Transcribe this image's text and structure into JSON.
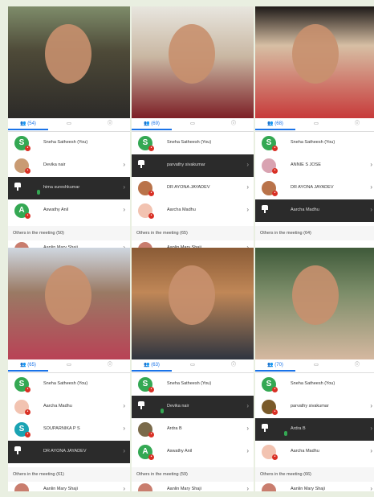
{
  "panels": [
    {
      "count": "(54)",
      "rows": [
        {
          "name": "Sneha Satheesh (You)",
          "avatar": "S",
          "color": "#34a853",
          "dark": false,
          "mic": false
        },
        {
          "name": "Devika nair",
          "avatar": "",
          "color": "#c99b73",
          "dark": false,
          "mic": false
        },
        {
          "name": "hima sureshkumar",
          "avatar": "",
          "color": "#2b2b2b",
          "dark": true,
          "mic": true
        },
        {
          "name": "Aswathy Anil",
          "avatar": "A",
          "color": "#34a853",
          "dark": false,
          "mic": false
        }
      ],
      "others": "Others in the meeting (50)",
      "next": "Aanlin Mary Shaji"
    },
    {
      "count": "(69)",
      "rows": [
        {
          "name": "Sneha Satheesh (You)",
          "avatar": "S",
          "color": "#34a853",
          "dark": false,
          "mic": false
        },
        {
          "name": "parvathy sivakumar",
          "avatar": "",
          "color": "#2b2b2b",
          "dark": true,
          "mic": false
        },
        {
          "name": "DR AYONA JAYADEV",
          "avatar": "",
          "color": "#b9734a",
          "dark": false,
          "mic": false
        },
        {
          "name": "Aarcha Madhu",
          "avatar": "",
          "color": "#f2c3b1",
          "dark": false,
          "mic": false
        }
      ],
      "others": "Others in the meeting (65)",
      "next": "Aanlin Mary Shaji"
    },
    {
      "count": "(68)",
      "rows": [
        {
          "name": "Sneha Satheesh (You)",
          "avatar": "S",
          "color": "#34a853",
          "dark": false,
          "mic": false
        },
        {
          "name": "ANNIE S JOSE",
          "avatar": "",
          "color": "#d9a3b1",
          "dark": false,
          "mic": false
        },
        {
          "name": "DR AYONA JAYADEV",
          "avatar": "",
          "color": "#b9734a",
          "dark": false,
          "mic": false
        },
        {
          "name": "Aarcha Madhu",
          "avatar": "",
          "color": "#2b2b2b",
          "dark": true,
          "mic": false
        }
      ],
      "others": "Others in the meeting (64)",
      "next": ""
    },
    {
      "count": "(65)",
      "rows": [
        {
          "name": "Sneha Satheesh (You)",
          "avatar": "S",
          "color": "#34a853",
          "dark": false,
          "mic": false
        },
        {
          "name": "Aarcha Madhu",
          "avatar": "",
          "color": "#f2c3b1",
          "dark": false,
          "mic": false
        },
        {
          "name": "SOUPARNIKA P S",
          "avatar": "S",
          "color": "#1aa3b3",
          "dark": false,
          "mic": false
        },
        {
          "name": "DR AYONA JAYADEV",
          "avatar": "",
          "color": "#2b2b2b",
          "dark": true,
          "mic": false
        }
      ],
      "others": "Others in the meeting (61)",
      "next": "Aanlin Mary Shaji"
    },
    {
      "count": "(63)",
      "rows": [
        {
          "name": "Sneha Satheesh (You)",
          "avatar": "S",
          "color": "#34a853",
          "dark": false,
          "mic": false
        },
        {
          "name": "Devika nair",
          "avatar": "",
          "color": "#2b2b2b",
          "dark": true,
          "mic": true
        },
        {
          "name": "Ardra B",
          "avatar": "",
          "color": "#7a6a4a",
          "dark": false,
          "mic": false
        },
        {
          "name": "Aswathy Anil",
          "avatar": "A",
          "color": "#34a853",
          "dark": false,
          "mic": false
        }
      ],
      "others": "Others in the meeting (59)",
      "next": "Aanlin Mary Shaji"
    },
    {
      "count": "(70)",
      "rows": [
        {
          "name": "Sneha Satheesh (You)",
          "avatar": "S",
          "color": "#34a853",
          "dark": false,
          "mic": false
        },
        {
          "name": "parvathy sivakumar",
          "avatar": "",
          "color": "#7a5a2a",
          "dark": false,
          "mic": false
        },
        {
          "name": "Ardra B",
          "avatar": "",
          "color": "#2b2b2b",
          "dark": true,
          "mic": true
        },
        {
          "name": "Aarcha Madhu",
          "avatar": "",
          "color": "#f2c3b1",
          "dark": false,
          "mic": false
        }
      ],
      "others": "Others in the meeting (66)",
      "next": "Aanlin Mary Shaji"
    }
  ],
  "icons": {
    "people": "people-icon",
    "chat": "chat-icon",
    "info": "info-icon",
    "chevron": "chevron-right-icon"
  },
  "colors": {
    "accent": "#1a73e8",
    "badge": "#d93025",
    "avatar_green": "#34a853"
  }
}
